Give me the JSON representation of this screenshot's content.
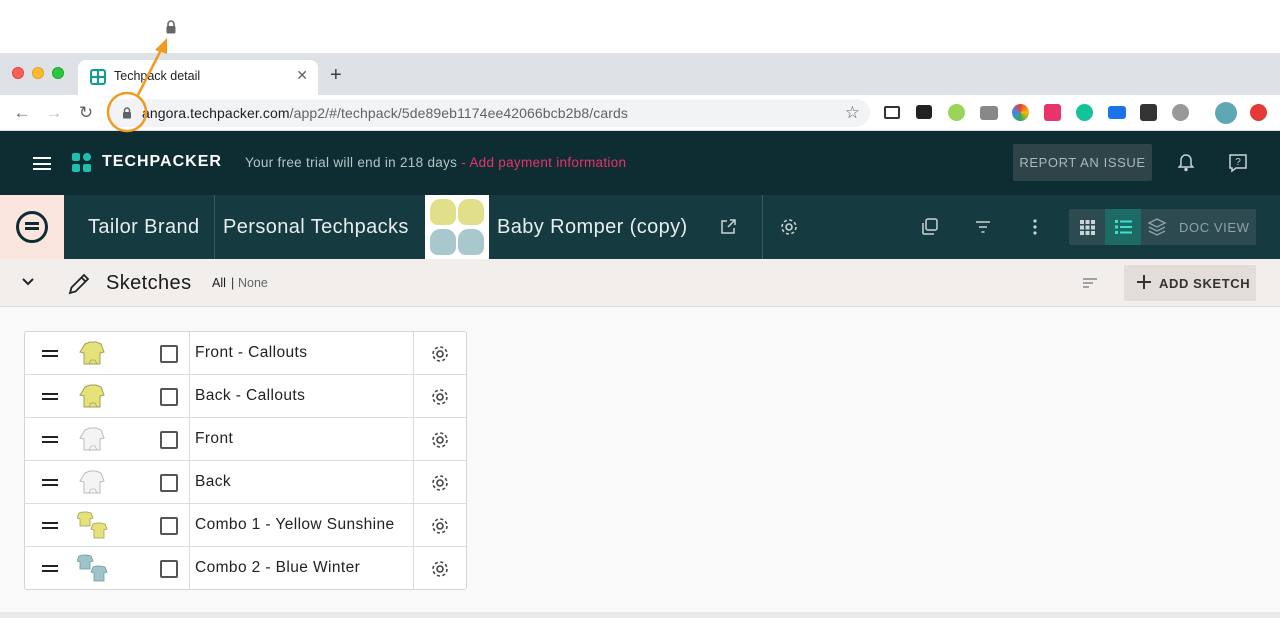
{
  "browser": {
    "tab_title": "Techpack detail",
    "url_host": "angora.techpacker.com",
    "url_path": "/app2/#/techpack/5de89eb1174ee42066bcb2b8/cards"
  },
  "header": {
    "logo": "TECHPACKER",
    "trial_text": "Your free trial will end in 218 days",
    "trial_link": "- Add payment information",
    "report_button": "REPORT AN ISSUE"
  },
  "breadcrumb": {
    "brand": "Tailor Brand",
    "folder": "Personal Techpacks",
    "techpack": "Baby Romper (copy)",
    "doc_view": "DOC VIEW"
  },
  "section": {
    "title": "Sketches",
    "select_all": "All",
    "select_sep": "|",
    "select_none": "None",
    "add_button": "ADD SKETCH"
  },
  "sketches": [
    {
      "name": "Front - Callouts",
      "color": "#e6e27a"
    },
    {
      "name": "Back - Callouts",
      "color": "#e6e27a"
    },
    {
      "name": "Front",
      "color": "#f4f4f4"
    },
    {
      "name": "Back",
      "color": "#f4f4f4"
    },
    {
      "name": "Combo 1 - Yellow Sunshine",
      "color": "#e6e27a"
    },
    {
      "name": "Combo 2 - Blue Winter",
      "color": "#9ec3c9"
    }
  ],
  "colors": {
    "header_bg": "#0e2d33",
    "accent": "#1fbfae",
    "link_pink": "#e8336b",
    "annotation": "#f29a1f"
  }
}
